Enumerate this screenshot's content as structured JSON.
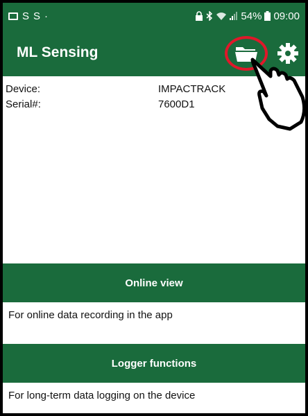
{
  "status_bar": {
    "left_icons": [
      "gallery-icon",
      "s-icon",
      "s-icon",
      "dot-icon"
    ],
    "left_s1": "S",
    "left_s2": "S",
    "left_dot": "·",
    "battery_percent": "54%",
    "time": "09:00"
  },
  "app_bar": {
    "title": "ML Sensing",
    "folder_icon": "folder-icon",
    "settings_icon": "gear-icon"
  },
  "device": {
    "device_label": "Device:",
    "device_value": "IMPACTRACK",
    "serial_label": "Serial#:",
    "serial_value": "7600D1"
  },
  "sections": [
    {
      "title": "Online view",
      "description": "For online data recording in the app"
    },
    {
      "title": "Logger functions",
      "description": "For long-term data logging on the device"
    }
  ],
  "colors": {
    "primary_green": "#1a6b3c",
    "highlight_red": "#e0182a"
  }
}
